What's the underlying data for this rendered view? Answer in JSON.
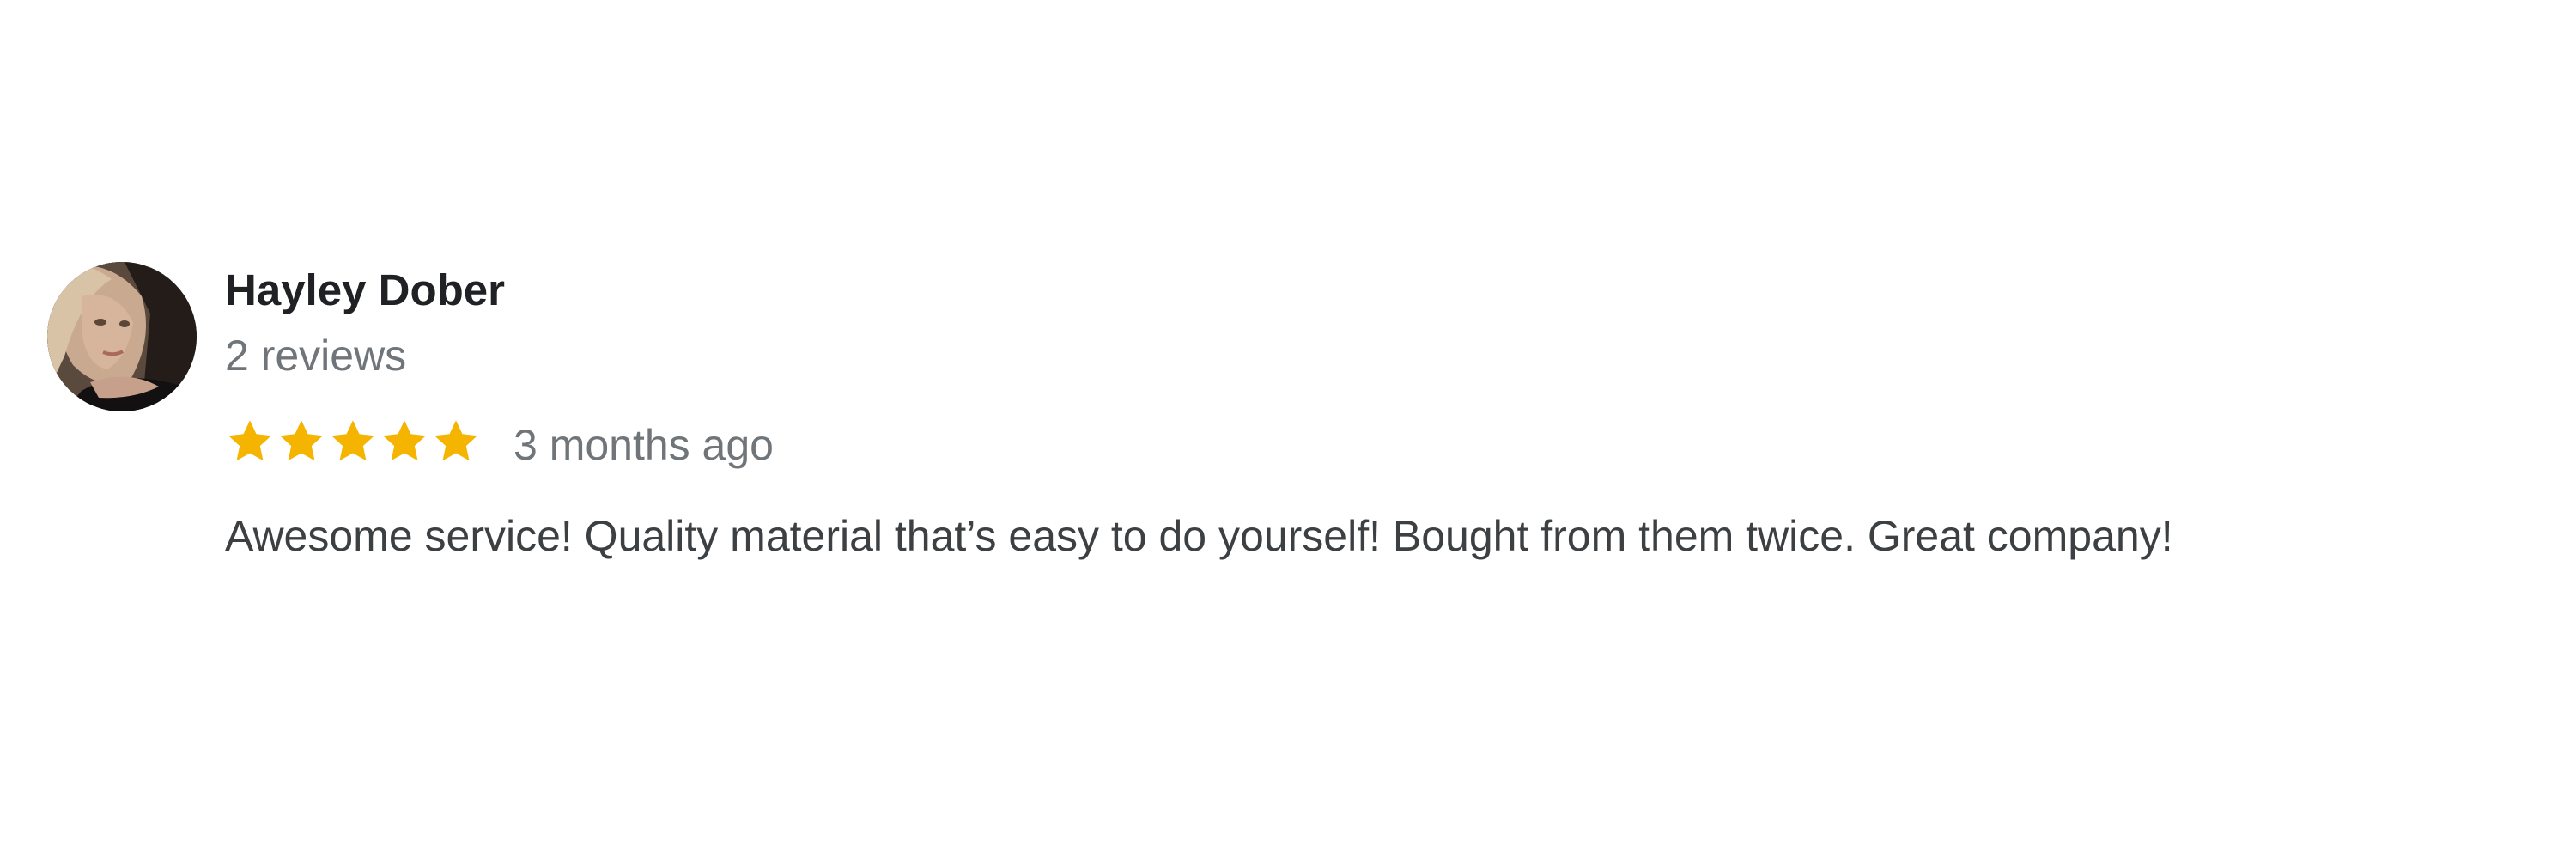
{
  "review": {
    "author": "Hayley Dober",
    "review_count": "2 reviews",
    "rating": 5,
    "max_rating": 5,
    "time_ago": "3 months ago",
    "text": "Awesome service! Quality material that’s easy to do yourself! Bought from them twice. Great company!",
    "star_color": "#f4b400"
  }
}
